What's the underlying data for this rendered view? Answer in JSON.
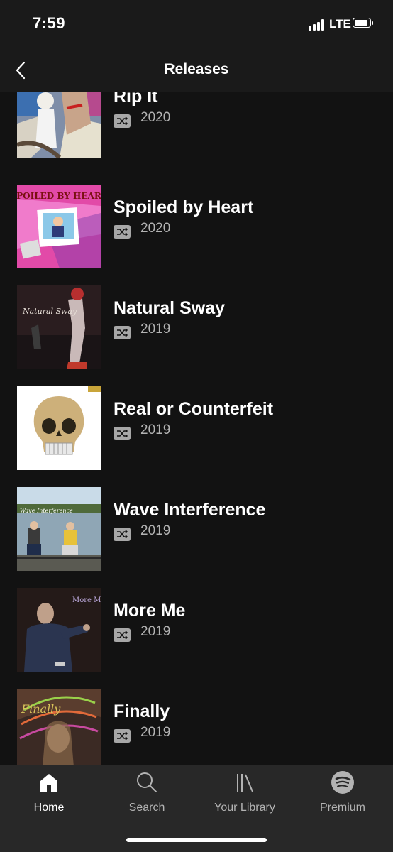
{
  "status": {
    "time": "7:59",
    "network": "LTE"
  },
  "header": {
    "title": "Releases"
  },
  "releases": [
    {
      "title": "Rip It",
      "year": "2020",
      "cover_icon": "album-cover-rip-it"
    },
    {
      "title": "Spoiled by Heart",
      "year": "2020",
      "cover_icon": "album-cover-spoiled-by-heart",
      "cover_text": "SPOILED BY HEART"
    },
    {
      "title": "Natural Sway",
      "year": "2019",
      "cover_icon": "album-cover-natural-sway",
      "cover_text": "Natural Sway"
    },
    {
      "title": "Real or Counterfeit",
      "year": "2019",
      "cover_icon": "album-cover-real-or-counterfeit"
    },
    {
      "title": "Wave Interference",
      "year": "2019",
      "cover_icon": "album-cover-wave-interference",
      "cover_text": "Wave Interference"
    },
    {
      "title": "More Me",
      "year": "2019",
      "cover_icon": "album-cover-more-me",
      "cover_text": "More Me"
    },
    {
      "title": "Finally",
      "year": "2019",
      "cover_icon": "album-cover-finally",
      "cover_text": "Finally"
    }
  ],
  "nav": {
    "items": [
      {
        "label": "Home",
        "icon": "home-icon",
        "active": true
      },
      {
        "label": "Search",
        "icon": "search-icon",
        "active": false
      },
      {
        "label": "Your Library",
        "icon": "library-icon",
        "active": false
      },
      {
        "label": "Premium",
        "icon": "spotify-logo-icon",
        "active": false
      }
    ]
  },
  "colors": {
    "background": "#121212",
    "header": "#1a1a1a",
    "nav": "#282828",
    "secondary_text": "#b3b3b3"
  }
}
